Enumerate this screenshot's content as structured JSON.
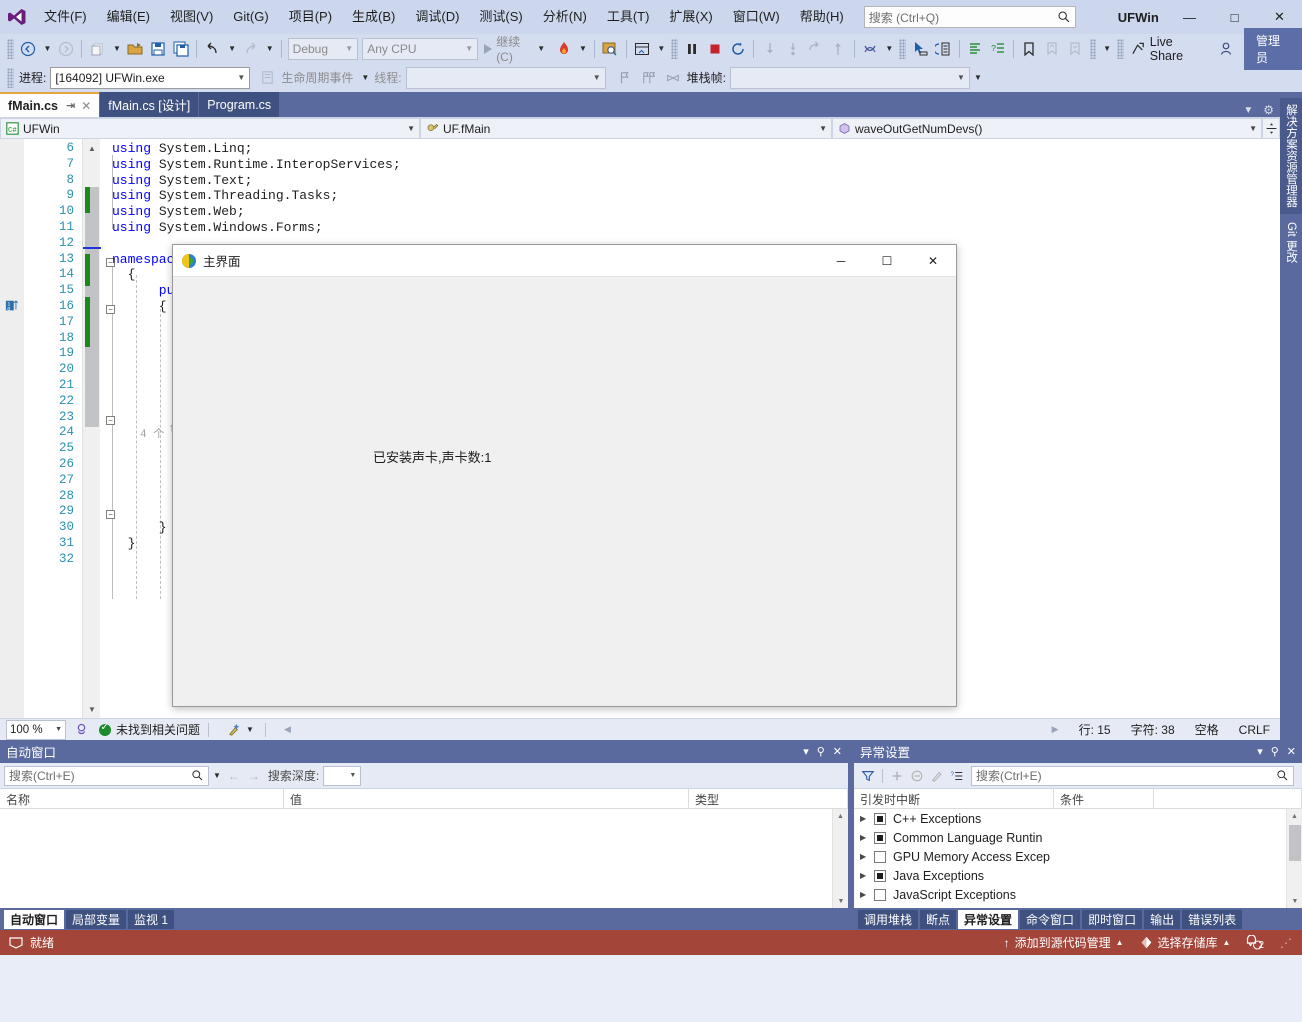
{
  "titlebar": {
    "logo_icon": "visual-studio-logo",
    "menus": [
      {
        "label": "文件(F)"
      },
      {
        "label": "编辑(E)"
      },
      {
        "label": "视图(V)"
      },
      {
        "label": "Git(G)"
      },
      {
        "label": "项目(P)"
      },
      {
        "label": "生成(B)"
      },
      {
        "label": "调试(D)"
      },
      {
        "label": "测试(S)"
      },
      {
        "label": "分析(N)"
      },
      {
        "label": "工具(T)"
      },
      {
        "label": "扩展(X)"
      },
      {
        "label": "窗口(W)"
      },
      {
        "label": "帮助(H)"
      }
    ],
    "search_placeholder": "搜索 (Ctrl+Q)",
    "app_title": "UFWin",
    "minimize": "—",
    "maximize": "□",
    "close": "✕"
  },
  "toolbar": {
    "config": "Debug",
    "platform": "Any CPU",
    "run_label": "继续(C)",
    "live_share": "Live Share",
    "admin_label": "管理员"
  },
  "processbar": {
    "process_label": "进程:",
    "process_value": "[164092] UFWin.exe",
    "lifecycle_label": "生命周期事件",
    "thread_label": "线程:",
    "thread_value": "",
    "stackframe_label": "堆栈帧:",
    "stackframe_value": ""
  },
  "editor": {
    "tabs": [
      {
        "label": "fMain.cs",
        "active": true
      },
      {
        "label": "fMain.cs [设计]",
        "active": false
      },
      {
        "label": "Program.cs",
        "active": false
      }
    ],
    "nav": {
      "project": "UFWin",
      "type": "UF.fMain",
      "member": "waveOutGetNumDevs()"
    },
    "lines": [
      {
        "n": 6,
        "indent": 0,
        "tokens": [
          {
            "t": "using",
            "c": "kw"
          },
          {
            "t": " System.Linq;",
            "c": "ns"
          }
        ]
      },
      {
        "n": 7,
        "indent": 0,
        "tokens": [
          {
            "t": "using",
            "c": "kw"
          },
          {
            "t": " System.Runtime.InteropServices;",
            "c": "ns"
          }
        ]
      },
      {
        "n": 8,
        "indent": 0,
        "tokens": [
          {
            "t": "using",
            "c": "kw"
          },
          {
            "t": " System.Text;",
            "c": "ns"
          }
        ]
      },
      {
        "n": 9,
        "indent": 0,
        "tokens": [
          {
            "t": "using",
            "c": "kw"
          },
          {
            "t": " System.Threading.Tasks;",
            "c": "ns"
          }
        ]
      },
      {
        "n": 10,
        "indent": 0,
        "tokens": [
          {
            "t": "using",
            "c": "kw"
          },
          {
            "t": " System.Web;",
            "c": "ns"
          }
        ]
      },
      {
        "n": 11,
        "indent": 0,
        "tokens": [
          {
            "t": "using",
            "c": "kw"
          },
          {
            "t": " System.Windows.Forms;",
            "c": "ns"
          }
        ]
      },
      {
        "n": 12,
        "indent": 0,
        "tokens": []
      },
      {
        "n": 13,
        "indent": 0,
        "tokens": [
          {
            "t": "namespac",
            "c": "kw"
          }
        ]
      },
      {
        "n": 14,
        "indent": 0,
        "tokens": [
          {
            "t": "  {",
            "c": "ns"
          }
        ]
      },
      {
        "n": 15,
        "indent": 0,
        "tokens": [
          {
            "t": "      publ",
            "c": "kw"
          }
        ]
      },
      {
        "n": 16,
        "indent": 0,
        "tokens": [
          {
            "t": "      {",
            "c": "ns"
          }
        ]
      },
      {
        "n": 17,
        "indent": 0,
        "tokens": []
      },
      {
        "n": 18,
        "indent": 0,
        "tokens": []
      },
      {
        "n": 19,
        "indent": 0,
        "tokens": []
      },
      {
        "n": 20,
        "indent": 0,
        "tokens": []
      },
      {
        "n": 21,
        "indent": 0,
        "tokens": []
      },
      {
        "n": 22,
        "indent": 0,
        "tokens": []
      },
      {
        "n": 23,
        "indent": 0,
        "tokens": []
      },
      {
        "n": 24,
        "indent": 0,
        "tokens": []
      },
      {
        "n": 25,
        "indent": 0,
        "tokens": []
      },
      {
        "n": 26,
        "indent": 0,
        "tokens": []
      },
      {
        "n": 27,
        "indent": 0,
        "tokens": []
      },
      {
        "n": 28,
        "indent": 0,
        "tokens": []
      },
      {
        "n": 29,
        "indent": 0,
        "tokens": []
      },
      {
        "n": 30,
        "indent": 0,
        "tokens": [
          {
            "t": "      }",
            "c": "ns"
          }
        ]
      },
      {
        "n": 31,
        "indent": 0,
        "tokens": [
          {
            "t": "  }",
            "c": "ns"
          }
        ]
      },
      {
        "n": 32,
        "indent": 0,
        "tokens": []
      }
    ],
    "codelens": "4 个",
    "status": {
      "zoom": "100 %",
      "problems": "未找到相关问题",
      "line": "行: 15",
      "col": "字符: 38",
      "spaces": "空格",
      "eol": "CRLF"
    }
  },
  "rightrail": {
    "tabs": [
      {
        "label": "解决方案资源管理器"
      },
      {
        "label": "Git 更改"
      }
    ]
  },
  "dialog": {
    "title": "主界面",
    "message": "已安装声卡,声卡数:1",
    "minimize": "─",
    "maximize": "☐",
    "close": "✕"
  },
  "autos_panel": {
    "title": "自动窗口",
    "search_placeholder": "搜索(Ctrl+E)",
    "depth_label": "搜索深度:",
    "depth_value": "",
    "columns": [
      "名称",
      "值",
      "类型"
    ],
    "rows": []
  },
  "exceptions_panel": {
    "title": "异常设置",
    "search_placeholder": "搜索(Ctrl+E)",
    "columns": [
      "引发时中断",
      "条件",
      ""
    ],
    "rows": [
      {
        "label": "C++ Exceptions",
        "checked": true
      },
      {
        "label": "Common Language Runtin",
        "checked": true
      },
      {
        "label": "GPU Memory Access Excep",
        "checked": false
      },
      {
        "label": "Java Exceptions",
        "checked": true
      },
      {
        "label": "JavaScript Exceptions",
        "checked": false
      }
    ]
  },
  "left_dock_tabs": [
    {
      "label": "自动窗口",
      "active": true
    },
    {
      "label": "局部变量",
      "active": false
    },
    {
      "label": "监视 1",
      "active": false
    }
  ],
  "right_dock_tabs": [
    {
      "label": "调用堆栈",
      "active": false
    },
    {
      "label": "断点",
      "active": false
    },
    {
      "label": "异常设置",
      "active": true
    },
    {
      "label": "命令窗口",
      "active": false
    },
    {
      "label": "即时窗口",
      "active": false
    },
    {
      "label": "输出",
      "active": false
    },
    {
      "label": "错误列表",
      "active": false
    }
  ],
  "statusbar": {
    "state": "就绪",
    "source_control": "添加到源代码管理",
    "repo": "选择存储库",
    "notifications": "2"
  },
  "colors": {
    "accent_orange": "#e2a53f",
    "status_red": "#a4453a",
    "chrome_blue": "#5b6a9e",
    "keyword_blue": "#0000ff",
    "linenum_teal": "#2b91af",
    "change_green": "#1a8a1a"
  }
}
